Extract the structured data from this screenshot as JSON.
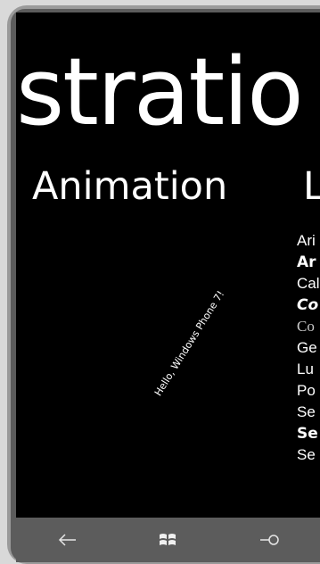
{
  "panorama": {
    "title": "stratio"
  },
  "items": [
    {
      "header": "Animation",
      "animated_text": "Hello, Windows Phone 7!"
    },
    {
      "header": "L",
      "fonts": [
        "Ari",
        "Ar",
        "Cal",
        "Co",
        "Co",
        "Ge",
        "Lu",
        "Po",
        "Se",
        "Se",
        "Se"
      ]
    }
  ],
  "system_bar": {
    "back_icon": "back-arrow-icon",
    "start_icon": "windows-logo-icon",
    "search_icon": "search-icon"
  }
}
